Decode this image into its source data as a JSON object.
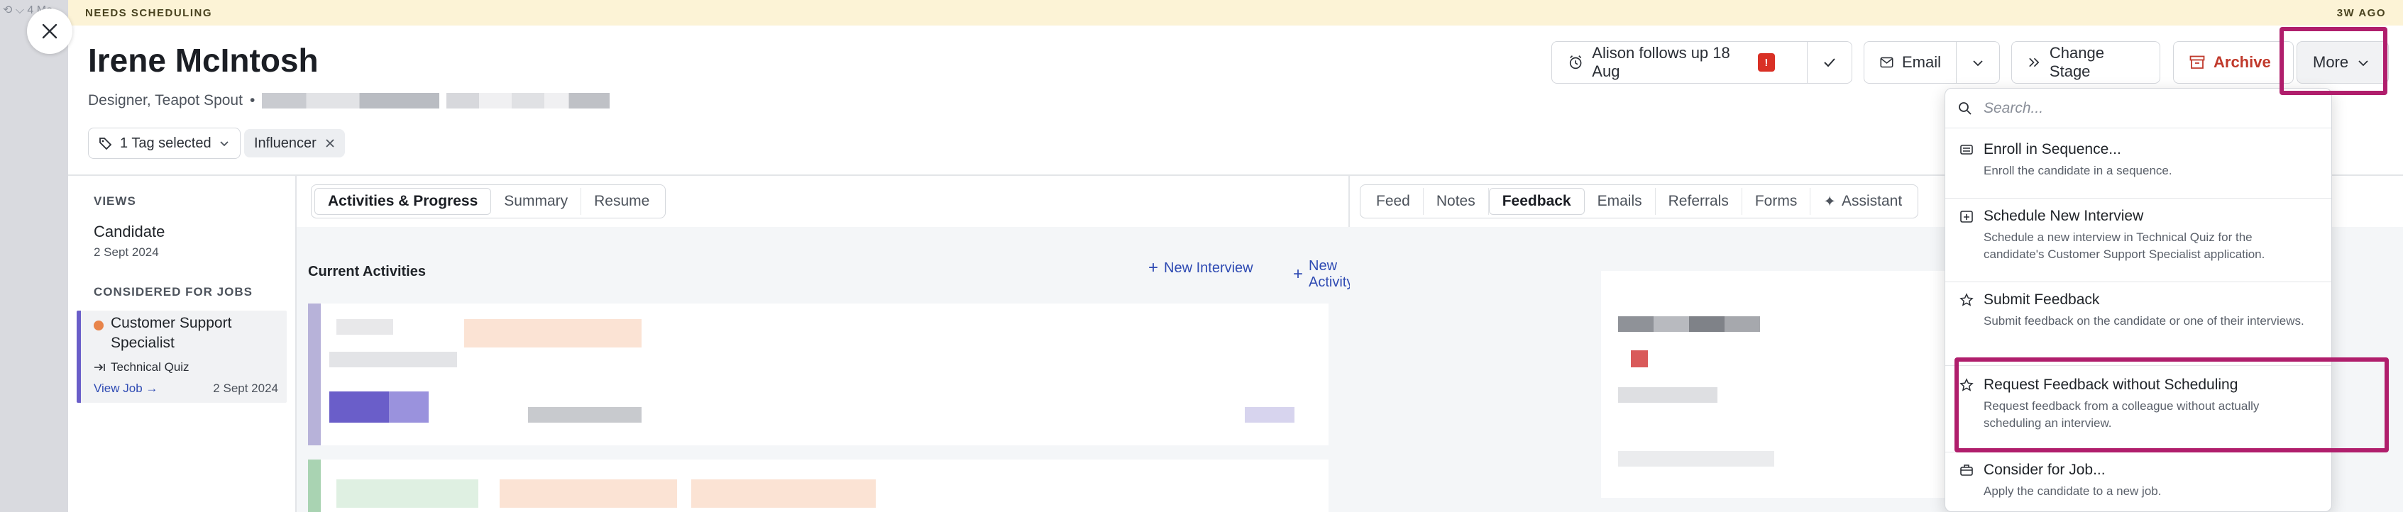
{
  "topleft": {
    "text": "⟲ ⌵ 4 Mo"
  },
  "banner": {
    "status": "NEEDS SCHEDULING",
    "age": "3W AGO"
  },
  "candidate": {
    "name": "Irene McIntosh",
    "subtitle": "Designer, Teapot Spout"
  },
  "tags": {
    "selector_label": "1 Tag selected",
    "chip": "Influencer"
  },
  "header_actions": {
    "followup": {
      "name": "Alison",
      "text": " follows up 18 Aug",
      "badge": "!"
    },
    "email": "Email",
    "change_stage": "Change Stage",
    "archive": "Archive",
    "more": "More"
  },
  "sidebar": {
    "views_heading": "VIEWS",
    "view_title": "Candidate",
    "view_date": "2 Sept 2024",
    "jobs_heading": "CONSIDERED FOR JOBS",
    "job_title_1": "Customer Support",
    "job_title_2": "Specialist",
    "job_stage": "Technical Quiz",
    "view_job": "View Job →",
    "job_date": "2 Sept 2024"
  },
  "middle": {
    "tabs": [
      "Activities & Progress",
      "Summary",
      "Resume"
    ],
    "current_activities": "Current Activities",
    "new_interview": "New Interview",
    "new_activity": "New Activity"
  },
  "right": {
    "tabs": [
      "Feed",
      "Notes",
      "Feedback",
      "Emails",
      "Referrals",
      "Forms",
      "Assistant"
    ]
  },
  "dropdown": {
    "search_placeholder": "Search...",
    "items": [
      {
        "label": "Enroll in Sequence...",
        "desc": "Enroll the candidate in a sequence."
      },
      {
        "label": "Schedule New Interview",
        "desc": "Schedule a new interview in Technical Quiz for the candidate's Customer Support Specialist application."
      },
      {
        "label": "Submit Feedback",
        "desc": "Submit feedback on the candidate or one of their interviews."
      },
      {
        "label": "Request Feedback without Scheduling",
        "desc": "Request feedback from a colleague without actually scheduling an interview."
      },
      {
        "label": "Consider for Job...",
        "desc": "Apply the candidate to a new job."
      }
    ]
  },
  "colors": {
    "accent": "#2f4bb3",
    "highlight": "#b01e6c",
    "archive": "#c0392b",
    "banner": "#fcf3d6",
    "job_dot": "#e8844a"
  }
}
